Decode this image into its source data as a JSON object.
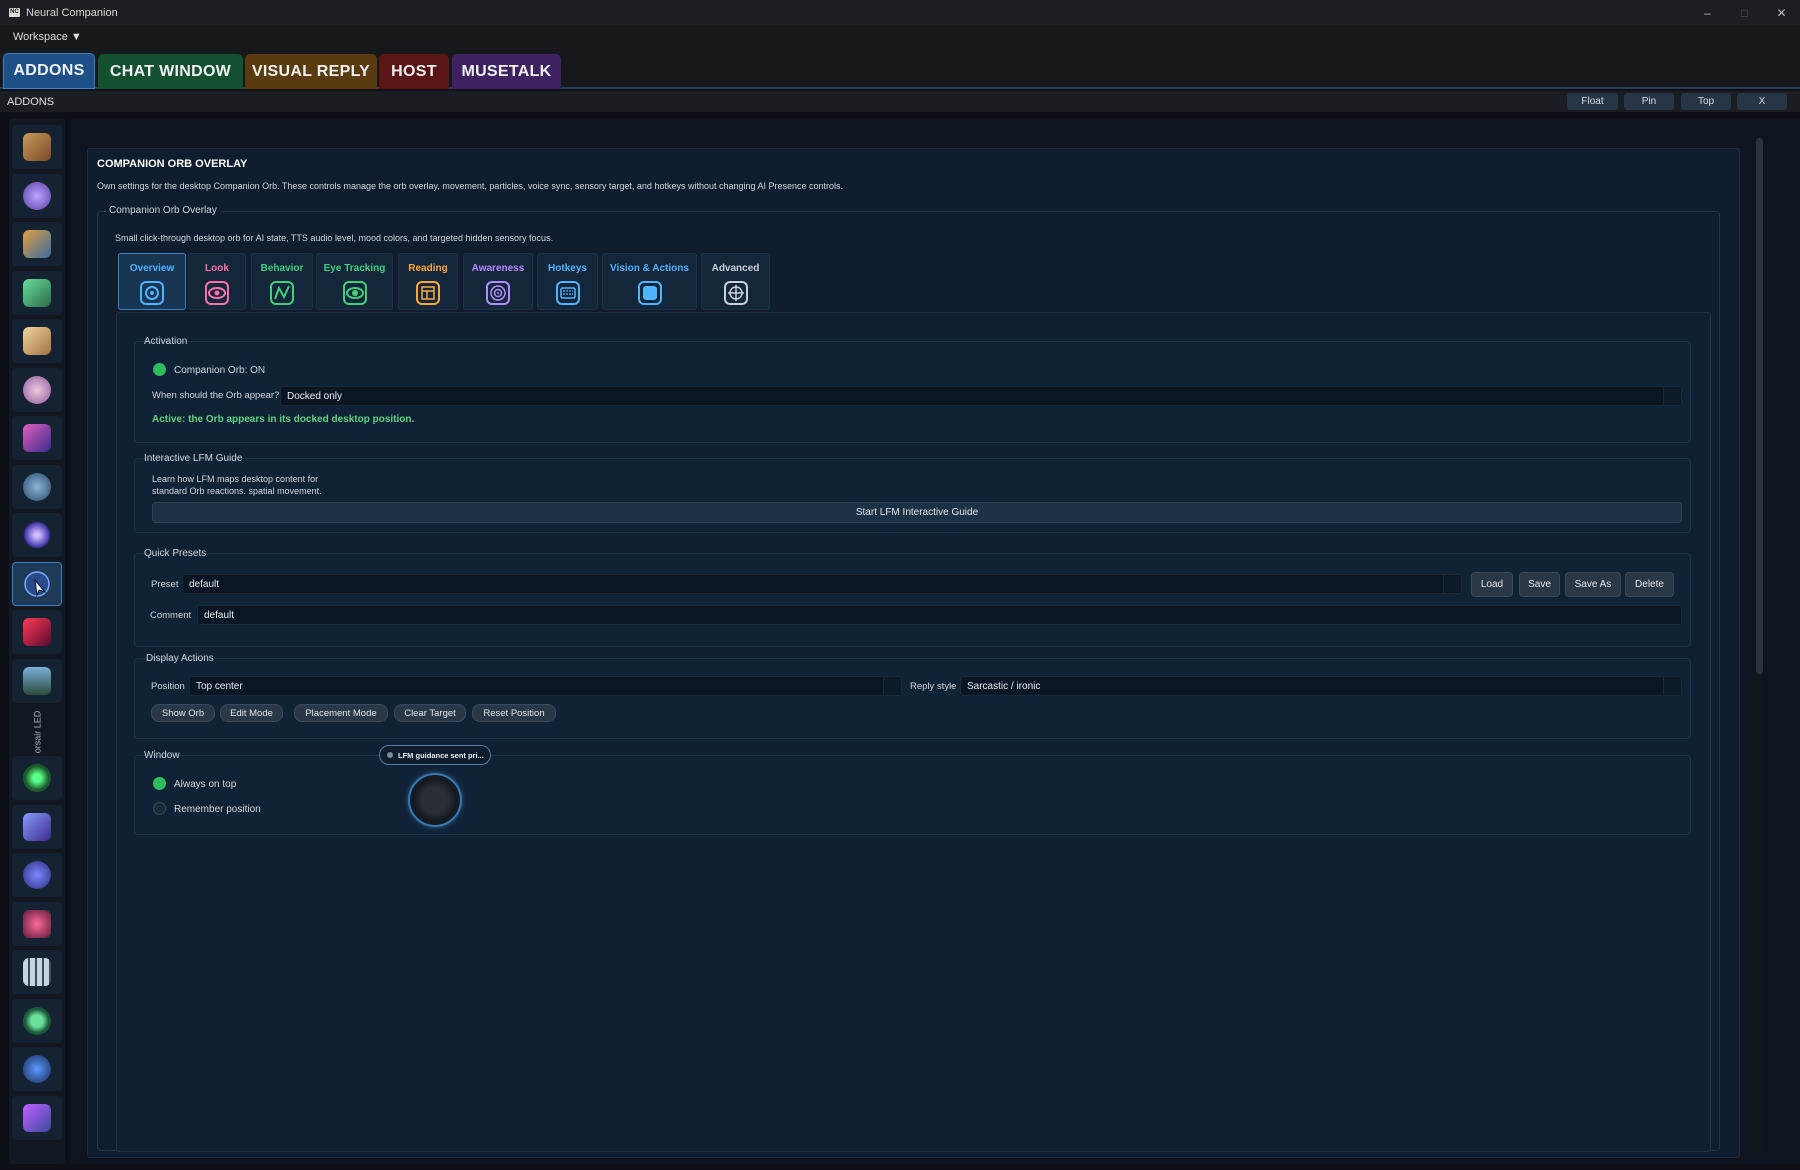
{
  "window": {
    "title": "Neural Companion",
    "app_icon": "NC",
    "controls": [
      "–",
      "□",
      "✕"
    ]
  },
  "menu": {
    "workspace": "Workspace ▼"
  },
  "tabs": [
    {
      "label": "ADDONS",
      "color": "#1e4f86"
    },
    {
      "label": "CHAT WINDOW",
      "color": "#12502f"
    },
    {
      "label": "VISUAL REPLY",
      "color": "#5a3b10"
    },
    {
      "label": "HOST",
      "color": "#5a1616"
    },
    {
      "label": "MUSETALK",
      "color": "#3e2260"
    }
  ],
  "subbar": {
    "title": "ADDONS",
    "buttons": [
      "Float",
      "Pin",
      "Top",
      "X"
    ]
  },
  "sidebar": {
    "items": [
      "face-pair-icon",
      "brain-icon",
      "dashboard-icon",
      "flask-icon",
      "book-icon",
      "face-icon",
      "avatar-icon",
      "globe-icon",
      "orb-icon",
      "cursor-orb-icon",
      "mask-icon",
      "landscape-icon",
      "led-label",
      "pulse-icon",
      "chat-bubbles-icon",
      "discord-icon",
      "star-icon",
      "keyboard-icon",
      "play-icon",
      "robot-icon",
      "gamepad-icon"
    ],
    "vertical_label": "orsair LED"
  },
  "panel": {
    "title": "COMPANION ORB OVERLAY",
    "description": "Own settings for the desktop Companion Orb. These controls manage the orb overlay, movement, particles, voice sync, sensory target, and hotkeys without changing AI Presence controls.",
    "group_title": "Companion Orb Overlay",
    "group_desc": "Small click-through desktop orb for AI state, TTS audio level, mood colors, and targeted hidden sensory focus.",
    "subtabs": [
      {
        "label": "Overview",
        "color": "#4fb3ff",
        "icon": "overview-icon"
      },
      {
        "label": "Look",
        "color": "#ff6fae",
        "icon": "eye-look-icon"
      },
      {
        "label": "Behavior",
        "color": "#3fd17a",
        "icon": "behavior-graph-icon"
      },
      {
        "label": "Eye Tracking",
        "color": "#3fd17a",
        "icon": "eye-tracking-icon"
      },
      {
        "label": "Reading",
        "color": "#ffa83a",
        "icon": "reading-icon"
      },
      {
        "label": "Awareness",
        "color": "#b58cff",
        "icon": "awareness-icon"
      },
      {
        "label": "Hotkeys",
        "color": "#4fb3ff",
        "icon": "hotkeys-icon"
      },
      {
        "label": "Vision & Actions",
        "color": "#4fb3ff",
        "icon": "vision-actions-icon"
      },
      {
        "label": "Advanced",
        "color": "#c9d1da",
        "icon": "advanced-icon"
      }
    ],
    "activation": {
      "title": "Activation",
      "orb_toggle": "Companion Orb: ON",
      "appear_label": "When should the Orb appear?",
      "appear_value": "Docked only",
      "status": "Active: the Orb appears in its docked desktop position."
    },
    "guide": {
      "title": "Interactive LFM Guide",
      "line1": "Learn how LFM maps desktop content for",
      "line2": "standard Orb reactions. spatial movement.",
      "button": "Start LFM Interactive Guide"
    },
    "presets": {
      "title": "Quick Presets",
      "preset_label": "Preset",
      "preset_value": "default",
      "comment_label": "Comment",
      "comment_value": "default",
      "buttons": [
        "Load",
        "Save",
        "Save As",
        "Delete"
      ]
    },
    "display": {
      "title": "Display  Actions",
      "position_label": "Position",
      "position_value": "Top center",
      "reply_label": "Reply style",
      "reply_value": "Sarcastic / ironic",
      "buttons": [
        "Show Orb",
        "Edit Mode",
        "Placement Mode",
        "Clear Target",
        "Reset Position"
      ]
    },
    "window": {
      "title": "Window",
      "always_on_top": "Always on top",
      "remember_position": "Remember position",
      "orb_tooltip": "LFM guidance sent pri..."
    }
  }
}
